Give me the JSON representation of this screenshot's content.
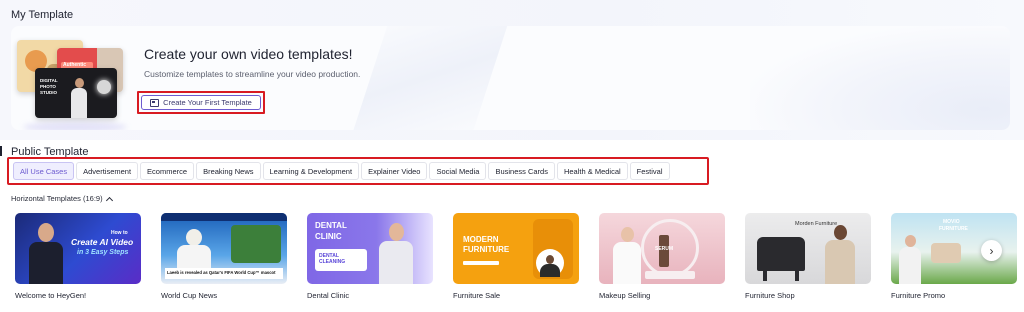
{
  "my_template": {
    "title": "My Template",
    "heading": "Create your own video templates!",
    "subtitle": "Customize templates to streamline your video production.",
    "create_button_label": "Create Your First Template",
    "illustration": {
      "card_label": "Authentic",
      "front_text": "DIGITAL PHOTO STUDIO"
    }
  },
  "public_template": {
    "title": "Public Template",
    "tabs": [
      {
        "label": "All Use Cases",
        "active": true
      },
      {
        "label": "Advertisement",
        "active": false
      },
      {
        "label": "Ecommerce",
        "active": false
      },
      {
        "label": "Breaking News",
        "active": false
      },
      {
        "label": "Learning & Development",
        "active": false
      },
      {
        "label": "Explainer Video",
        "active": false
      },
      {
        "label": "Social Media",
        "active": false
      },
      {
        "label": "Business Cards",
        "active": false
      },
      {
        "label": "Health & Medical",
        "active": false
      },
      {
        "label": "Festival",
        "active": false
      }
    ],
    "section_label": "Horizontal Templates (16:9)",
    "templates": [
      {
        "name": "Welcome to HeyGen!",
        "thumb_text_1": "How to",
        "thumb_text_2": "Create AI Video",
        "thumb_text_3": "in 3 Easy Steps"
      },
      {
        "name": "World Cup News",
        "thumb_text_1": "Laeeb is revealed as Qatar's FIFA World Cup™ mascot"
      },
      {
        "name": "Dental Clinic",
        "thumb_text_1": "DENTAL",
        "thumb_text_2": "CLINIC",
        "thumb_text_3": "DENTAL CLEANING"
      },
      {
        "name": "Furniture Sale",
        "thumb_text_1": "MODERN",
        "thumb_text_2": "FURNITURE"
      },
      {
        "name": "Makeup Selling",
        "thumb_text_1": "SERUM"
      },
      {
        "name": "Furniture Shop",
        "thumb_text_1": "Morden Furniture"
      },
      {
        "name": "Furniture Promo",
        "thumb_text_1": "MOVIO",
        "thumb_text_2": "FURNITURE"
      }
    ]
  },
  "icons": {
    "create_button_icon": "template-icon",
    "collapse_icon": "chevron-up-icon",
    "next_icon": "chevron-right-icon"
  },
  "colors": {
    "accent": "#6d5bd0",
    "highlight_box": "#d81b22",
    "active_tab_bg": "#efeefe"
  }
}
